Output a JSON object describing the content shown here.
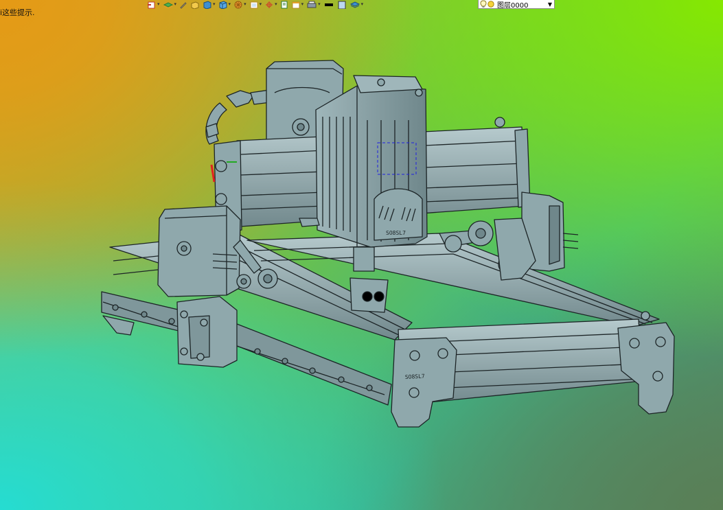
{
  "status": {
    "hint_text": "i这些提示."
  },
  "toolbar": {
    "buttons": [
      {
        "icon": "layer-back-icon"
      },
      {
        "icon": "layers-icon"
      },
      {
        "icon": "pencil-icon"
      },
      {
        "icon": "box-yellow-icon"
      },
      {
        "icon": "cube-blue-icon"
      },
      {
        "icon": "cube-blue-alt-icon"
      },
      {
        "icon": "wheel-icon"
      },
      {
        "icon": "frame-icon"
      },
      {
        "icon": "crosshair-icon"
      },
      {
        "icon": "page-icon"
      },
      {
        "icon": "window-icon"
      },
      {
        "icon": "printer-icon"
      },
      {
        "icon": "line-color-icon"
      },
      {
        "icon": "fill-icon"
      },
      {
        "icon": "layer-stack-icon"
      }
    ],
    "layer": {
      "value": "图层0000",
      "bulb_icon": "lightbulb-icon",
      "sun_icon": "sun-icon"
    }
  },
  "viewport": {
    "model": "CNC laser engraver assembly",
    "engraving_left": "SO8SL7",
    "engraving_right": "SO8SL7",
    "colors": {
      "body": "#8fa8ac",
      "edge": "#1c2426",
      "highlight": "#b6cacd",
      "shadow": "#6f878b"
    }
  }
}
